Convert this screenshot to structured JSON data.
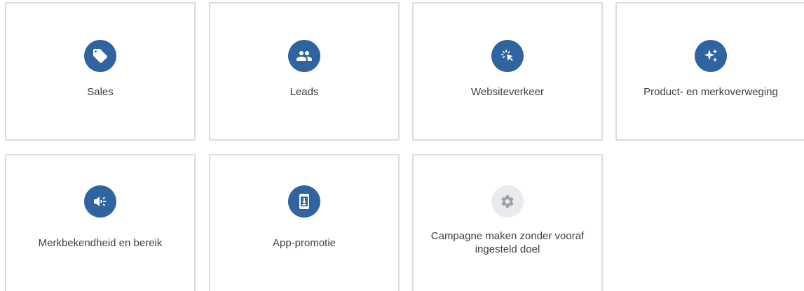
{
  "colors": {
    "icon_background": "#2f64a0",
    "icon_background_disabled": "#e8eaed",
    "icon_disabled_glyph": "#9aa0a6",
    "card_border": "#dadce0",
    "label_text": "#3c4043"
  },
  "goals": [
    {
      "label": "Sales",
      "icon": "tag-icon"
    },
    {
      "label": "Leads",
      "icon": "people-icon"
    },
    {
      "label": "Websiteverkeer",
      "icon": "cursor-click-icon"
    },
    {
      "label": "Product- en merkoverweging",
      "icon": "sparkle-icon"
    },
    {
      "label": "Merkbekendheid en bereik",
      "icon": "megaphone-icon"
    },
    {
      "label": "App-promotie",
      "icon": "phone-download-icon"
    },
    {
      "label": "Campagne maken zonder vooraf ingesteld doel",
      "icon": "gear-icon"
    }
  ]
}
